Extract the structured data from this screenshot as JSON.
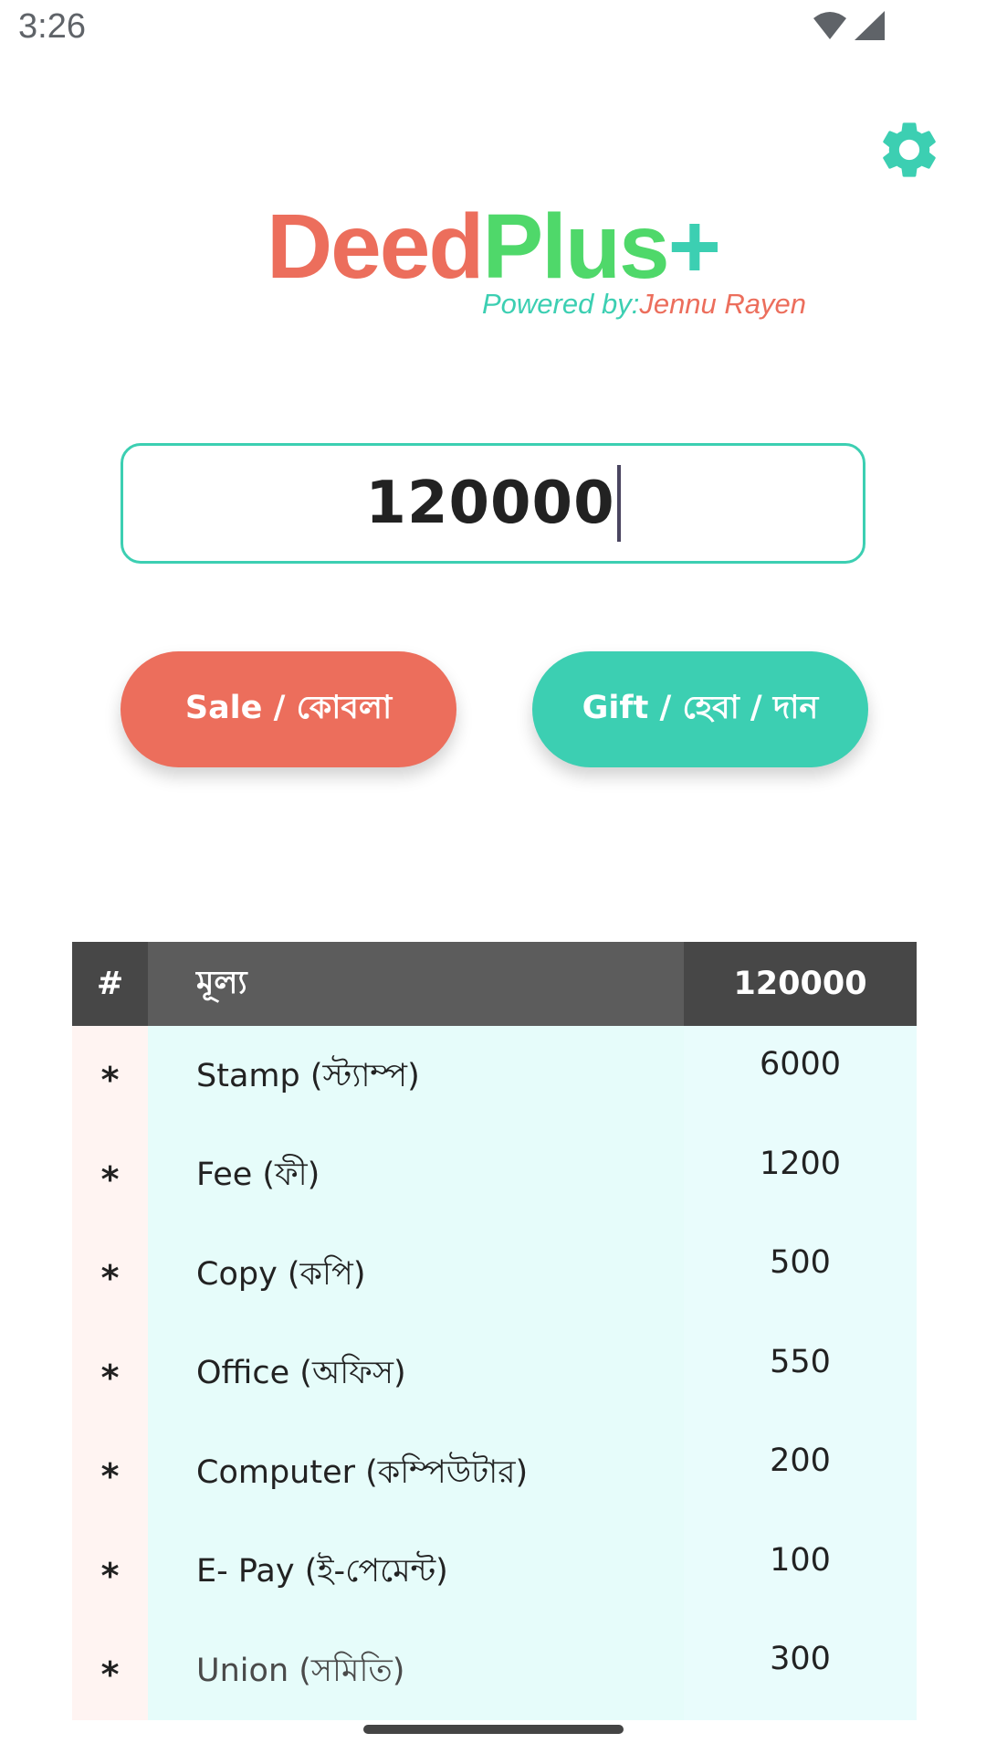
{
  "status_bar": {
    "time": "3:26",
    "icons": [
      "wifi-icon",
      "cellular-signal-icon"
    ]
  },
  "header": {
    "settings_icon": "gear-icon",
    "logo_part1": "Deed",
    "logo_part2": "Plus",
    "logo_part3": "+",
    "powered_label": "Powered by:",
    "powered_author": "Jennu Rayen"
  },
  "amount_input": {
    "value": "120000"
  },
  "actions": {
    "sale_label": "Sale / কোবলা",
    "gift_label": "Gift / হেবা / দান"
  },
  "table": {
    "headers": [
      "#",
      "মূল্য",
      "120000"
    ],
    "rows": [
      {
        "mark": "*",
        "label": "Stamp (স্ট্যাম্প)",
        "value": "6000"
      },
      {
        "mark": "*",
        "label": "Fee (ফী)",
        "value": "1200"
      },
      {
        "mark": "*",
        "label": "Copy (কপি)",
        "value": "500"
      },
      {
        "mark": "*",
        "label": "Office (অফিস)",
        "value": "550"
      },
      {
        "mark": "*",
        "label": "Computer (কম্পিউটার)",
        "value": "200"
      },
      {
        "mark": "*",
        "label": "E- Pay (ই-পেমেন্ট)",
        "value": "100"
      },
      {
        "mark": "*",
        "label": "Union (সমিতি)",
        "value": "300"
      }
    ]
  },
  "colors": {
    "accent_red": "#ec6e5c",
    "accent_teal": "#3ccfb2",
    "accent_green": "#4fd86a",
    "table_header_dark": "#474747",
    "table_header_mid": "#5c5c5c"
  }
}
